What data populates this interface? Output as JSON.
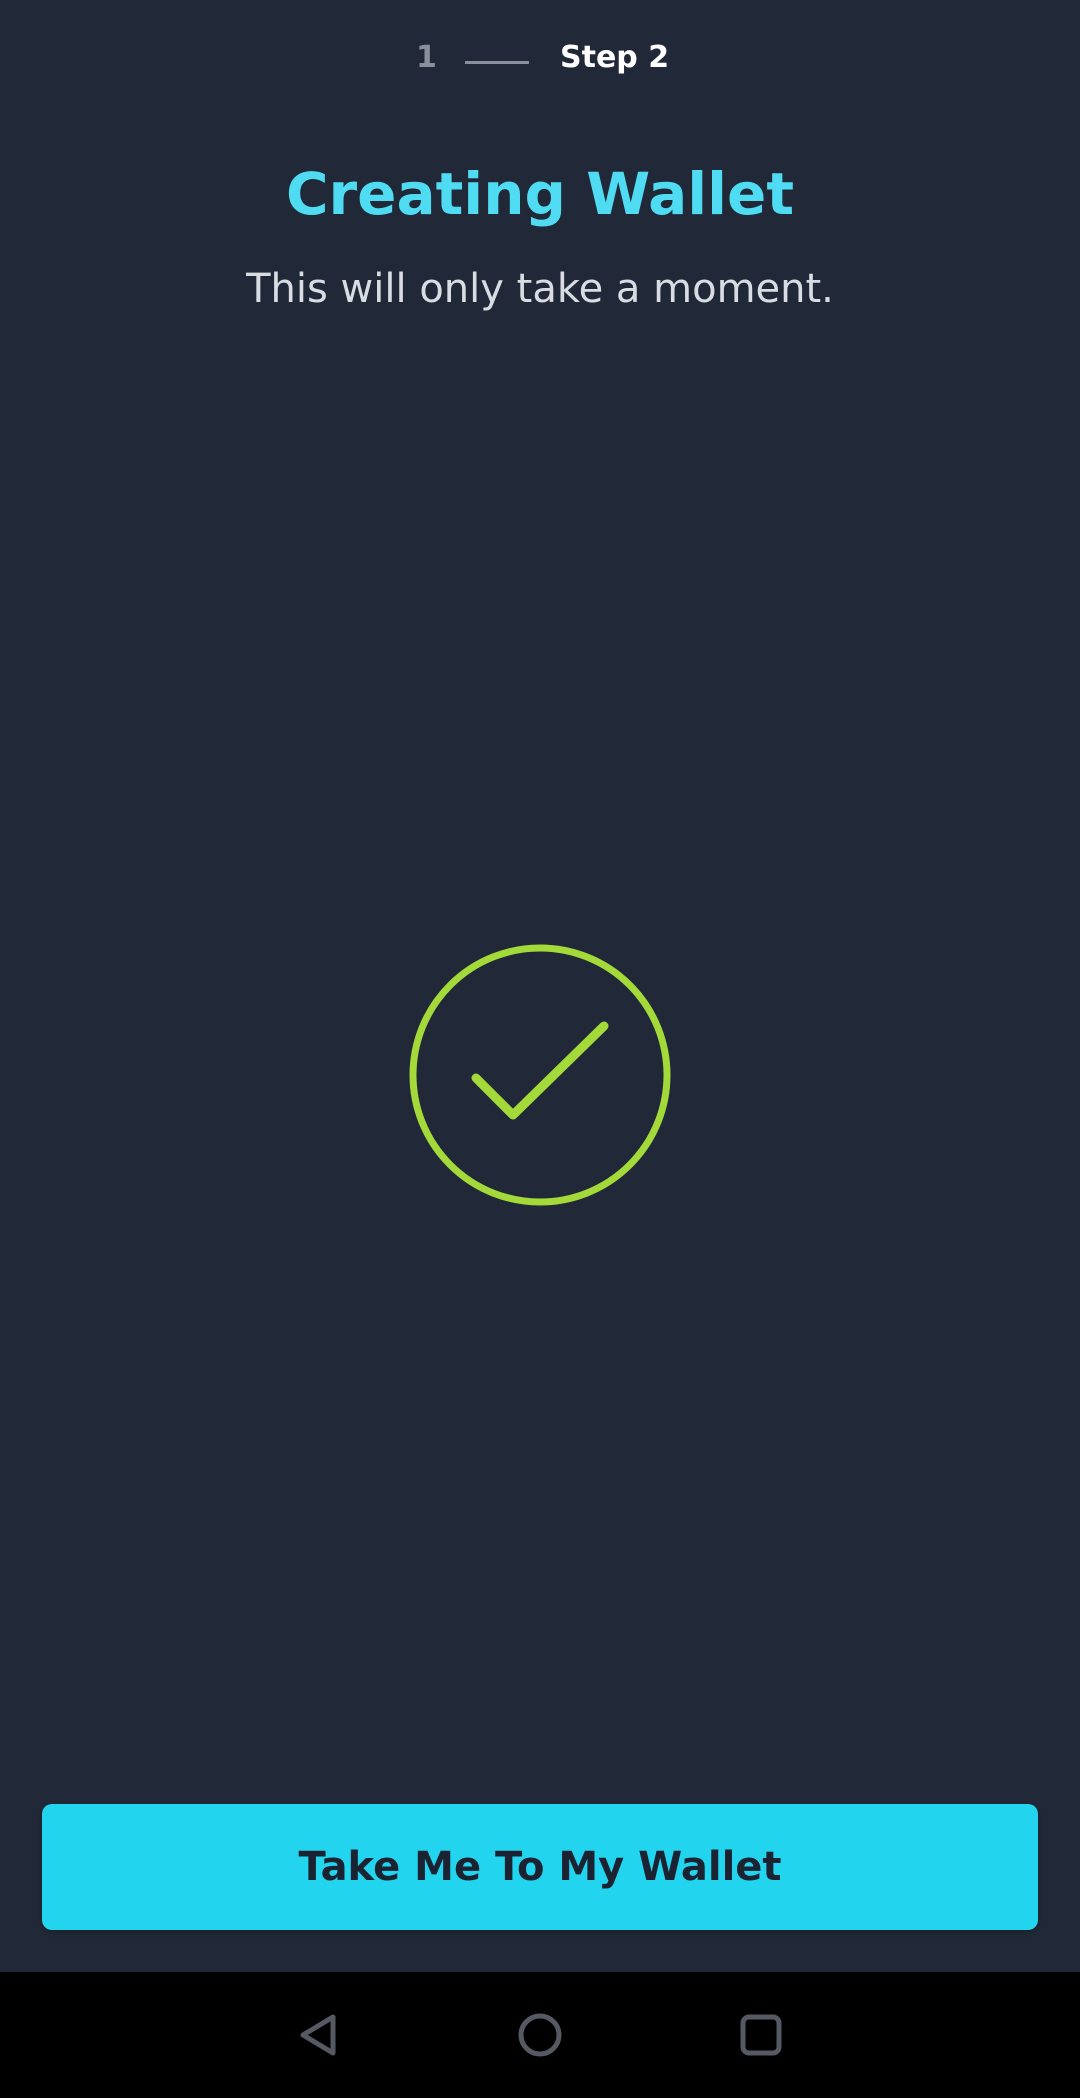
{
  "stepper": {
    "step1_label": "1",
    "step2_label": "Step 2"
  },
  "main": {
    "title": "Creating Wallet",
    "subtitle": "This will only take a moment.",
    "status_icon": "check-circle-icon"
  },
  "actions": {
    "primary_label": "Take Me To My Wallet"
  },
  "navbar": {
    "icons": [
      "back-icon",
      "home-icon",
      "recents-icon"
    ]
  },
  "colors": {
    "background": "#212938",
    "accent": "#22d4ed",
    "title": "#4fdcf2",
    "success": "#a4d93a"
  }
}
